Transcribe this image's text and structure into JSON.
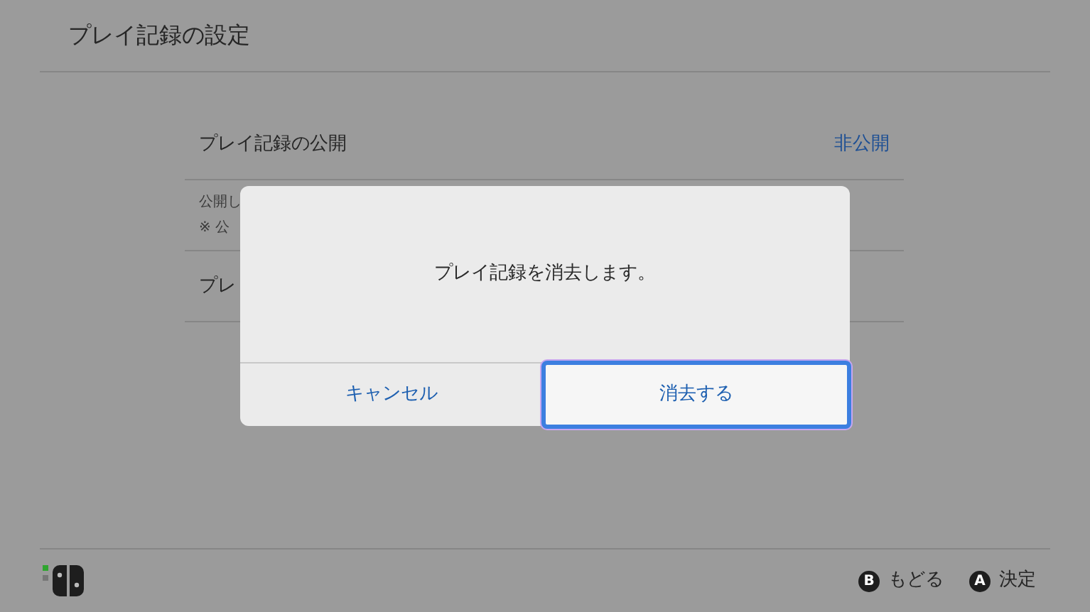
{
  "header": {
    "title": "プレイ記録の設定"
  },
  "settings": [
    {
      "kind": "option",
      "label": "プレイ記録の公開",
      "value": "非公開"
    },
    {
      "kind": "note",
      "lines": [
        "公開し",
        "※ 公"
      ]
    },
    {
      "kind": "option",
      "label": "プレ"
    }
  ],
  "dialog": {
    "message": "プレイ記録を消去します。",
    "buttons": [
      {
        "label": "キャンセル",
        "selected": false
      },
      {
        "label": "消去する",
        "selected": true
      }
    ]
  },
  "footer": {
    "hints": [
      {
        "key": "B",
        "label": "もどる"
      },
      {
        "key": "A",
        "label": "決定"
      }
    ]
  }
}
